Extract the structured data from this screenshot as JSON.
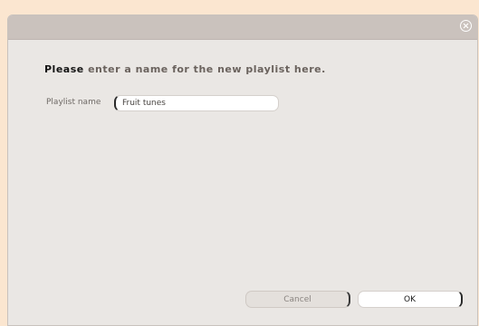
{
  "dialog": {
    "heading_strong": "Please",
    "heading_rest": " enter a name for the new playlist here.",
    "field_label": "Playlist name",
    "field_value": "Fruit tunes",
    "cancel_label": "Cancel",
    "ok_label": "OK"
  },
  "icons": {
    "close": "close-icon"
  },
  "colors": {
    "background": "#fbe6d0",
    "dialog": "#eae7e4",
    "titlebar": "#cac2bd"
  }
}
